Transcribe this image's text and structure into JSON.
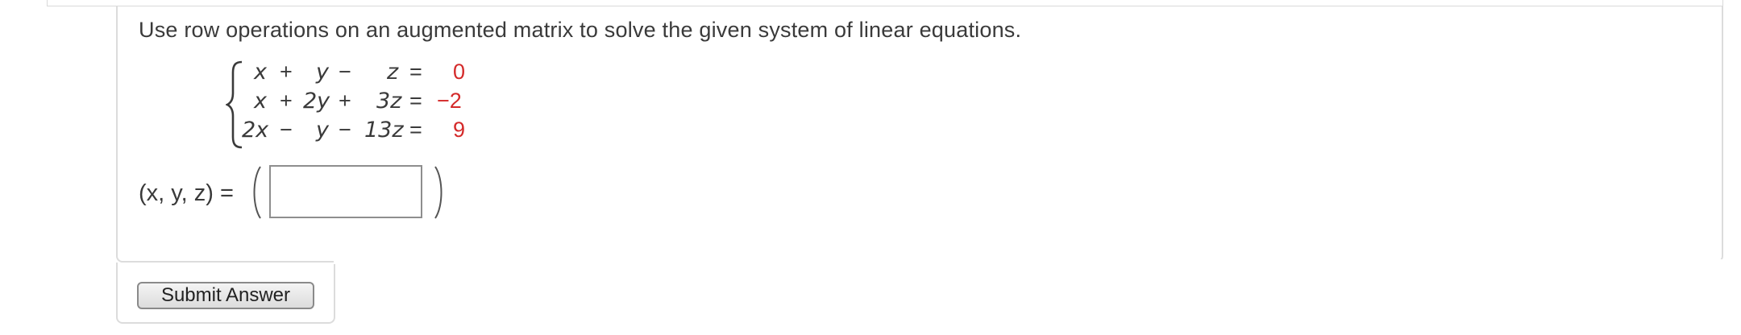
{
  "question": {
    "prompt": "Use row operations on an augmented matrix to solve the given system of linear equations.",
    "system": {
      "rows": [
        {
          "c1": "x",
          "op1": "+",
          "c2": "y",
          "op2": "−",
          "c3": "z",
          "eq": "=",
          "rhs": "0"
        },
        {
          "c1": "x",
          "op1": "+",
          "c2": "2y",
          "op2": "+",
          "c3": "3z",
          "eq": "=",
          "rhs": "−2"
        },
        {
          "c1": "2x",
          "op1": "−",
          "c2": "y",
          "op2": "−",
          "c3": "13z",
          "eq": "=",
          "rhs": "9"
        }
      ]
    },
    "answer_label": "(x, y, z) =",
    "answer_value": "",
    "rhs_color": "#d42a2a"
  },
  "footer": {
    "submit_label": "Submit Answer"
  }
}
